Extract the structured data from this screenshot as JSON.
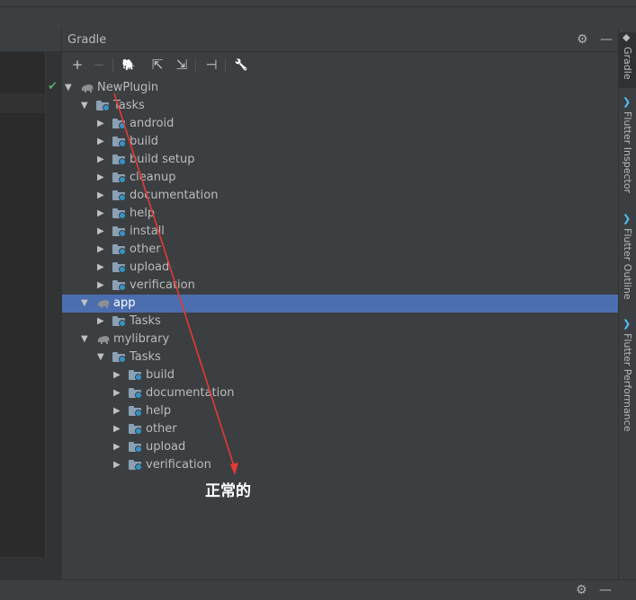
{
  "panel": {
    "title": "Gradle",
    "toolbar": [
      {
        "icon": "plus-icon",
        "glyph": "+",
        "enabled": true
      },
      {
        "icon": "minus-icon",
        "glyph": "−",
        "enabled": false
      },
      {
        "icon": "elephant-refresh-icon",
        "glyph": "🐘",
        "enabled": true
      },
      {
        "icon": "expand-all-icon",
        "glyph": "⇱",
        "enabled": true
      },
      {
        "icon": "collapse-all-icon",
        "glyph": "⇲",
        "enabled": true
      },
      {
        "icon": "toggle-offline-icon",
        "glyph": "⊣",
        "enabled": true
      },
      {
        "icon": "wrench-icon",
        "glyph": "🔧",
        "enabled": true
      }
    ]
  },
  "tree": [
    {
      "label": "NewPlugin",
      "kind": "project",
      "expanded": true,
      "depth": 0
    },
    {
      "label": "Tasks",
      "kind": "folder",
      "expanded": true,
      "depth": 1
    },
    {
      "label": "android",
      "kind": "folder",
      "expanded": false,
      "depth": 2
    },
    {
      "label": "build",
      "kind": "folder",
      "expanded": false,
      "depth": 2
    },
    {
      "label": "build setup",
      "kind": "folder",
      "expanded": false,
      "depth": 2
    },
    {
      "label": "cleanup",
      "kind": "folder",
      "expanded": false,
      "depth": 2
    },
    {
      "label": "documentation",
      "kind": "folder",
      "expanded": false,
      "depth": 2
    },
    {
      "label": "help",
      "kind": "folder",
      "expanded": false,
      "depth": 2
    },
    {
      "label": "install",
      "kind": "folder",
      "expanded": false,
      "depth": 2
    },
    {
      "label": "other",
      "kind": "folder",
      "expanded": false,
      "depth": 2
    },
    {
      "label": "upload",
      "kind": "folder",
      "expanded": false,
      "depth": 2
    },
    {
      "label": "verification",
      "kind": "folder",
      "expanded": false,
      "depth": 2
    },
    {
      "label": "app",
      "kind": "project",
      "expanded": true,
      "depth": 1,
      "selected": true
    },
    {
      "label": "Tasks",
      "kind": "folder",
      "expanded": false,
      "depth": 2
    },
    {
      "label": "mylibrary",
      "kind": "project",
      "expanded": true,
      "depth": 1
    },
    {
      "label": "Tasks",
      "kind": "folder",
      "expanded": true,
      "depth": 2
    },
    {
      "label": "build",
      "kind": "folder",
      "expanded": false,
      "depth": 3
    },
    {
      "label": "documentation",
      "kind": "folder",
      "expanded": false,
      "depth": 3
    },
    {
      "label": "help",
      "kind": "folder",
      "expanded": false,
      "depth": 3
    },
    {
      "label": "other",
      "kind": "folder",
      "expanded": false,
      "depth": 3
    },
    {
      "label": "upload",
      "kind": "folder",
      "expanded": false,
      "depth": 3
    },
    {
      "label": "verification",
      "kind": "folder",
      "expanded": false,
      "depth": 3
    }
  ],
  "right_strip": [
    {
      "label": "Gradle",
      "icon": "elephant-icon",
      "active": true
    },
    {
      "label": "Flutter Inspector",
      "icon": "flutter-icon",
      "active": false
    },
    {
      "label": "Flutter Outline",
      "icon": "flutter-icon",
      "active": false
    },
    {
      "label": "Flutter Performance",
      "icon": "flutter-icon",
      "active": false
    }
  ],
  "annotation": {
    "text": "正常的",
    "color": "#e53935"
  },
  "colors": {
    "selection": "#4b6eaf",
    "panel": "#3c3f41",
    "folder": "#8aa0b4",
    "gear": "#3592c4"
  }
}
